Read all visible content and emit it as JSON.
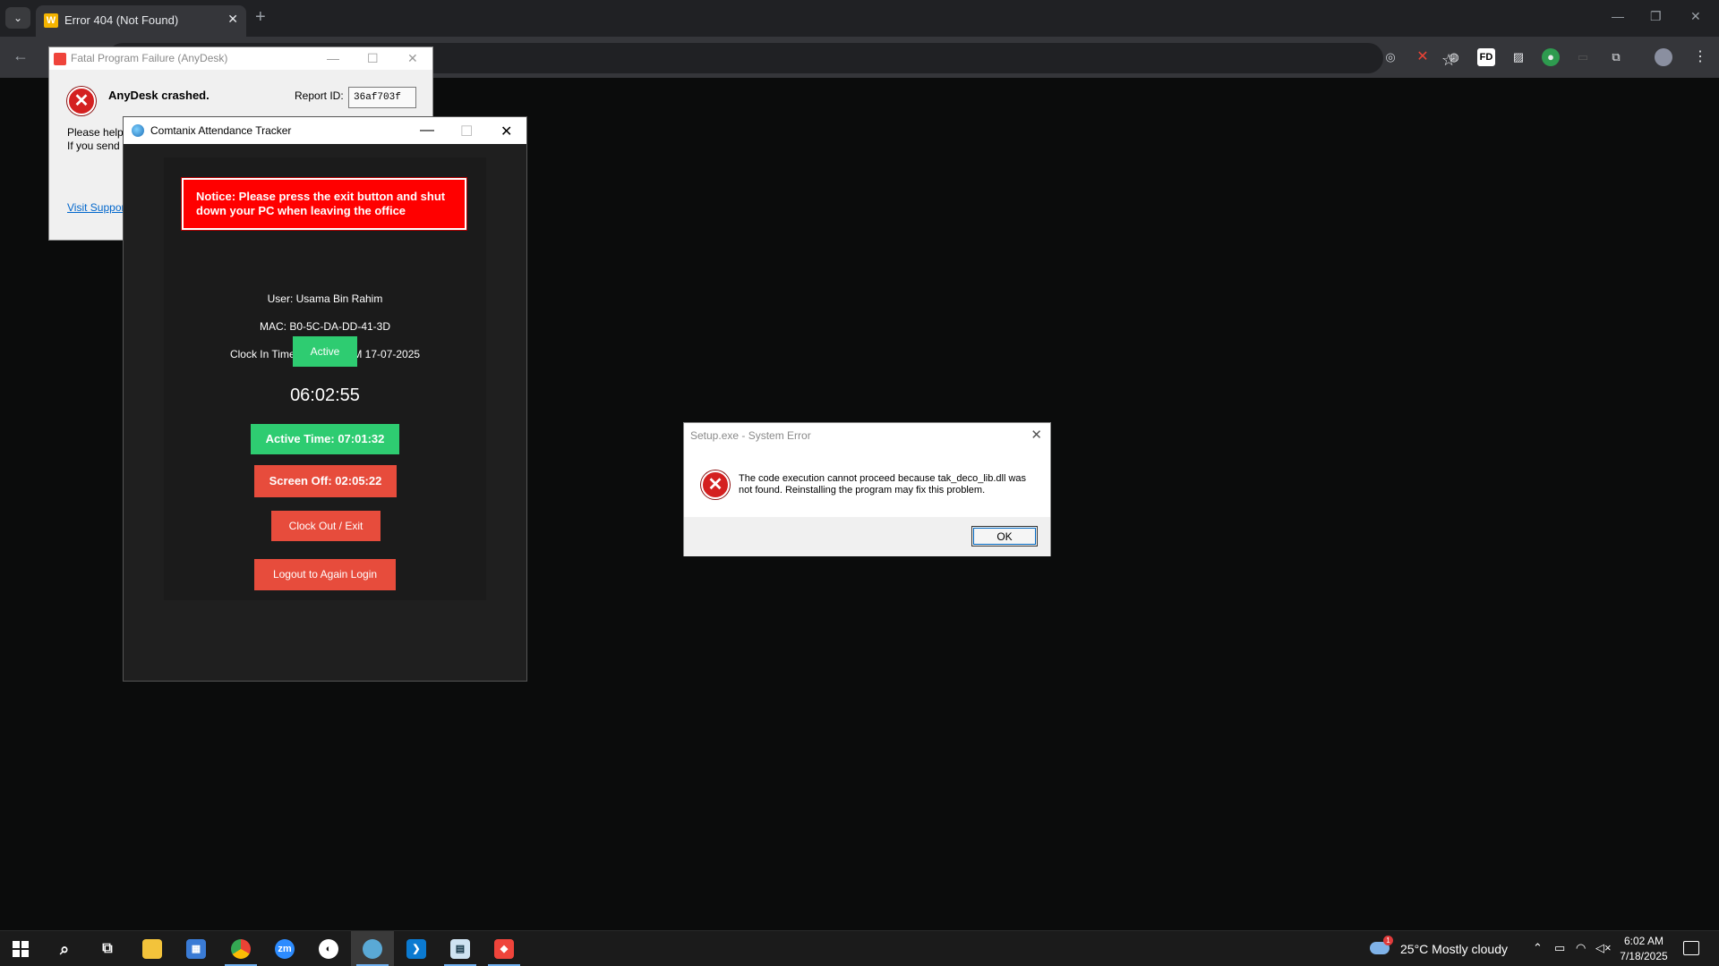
{
  "browser": {
    "tab_title": "Error 404 (Not Found)",
    "tab_favicon": "W",
    "new_tab": "+",
    "tab_close": "✕",
    "star_icon": "☆",
    "extensions_label": "FD"
  },
  "anydesk": {
    "title": "Fatal Program Failure (AnyDesk)",
    "heading": "AnyDesk crashed.",
    "report_label": "Report ID:",
    "report_id": "36af703f",
    "text_line1": "Please help",
    "text_line2": "If you send",
    "support_link": "Visit Suppor"
  },
  "tracker": {
    "title": "Comtanix Attendance Tracker",
    "notice": "Notice: Please press the exit button and shut down your PC when leaving the office",
    "user": "User: Usama Bin Rahim",
    "mac": "MAC: B0-5C-DA-DD-41-3D",
    "clock_in": "Clock In Time: 04:59:51 PM 17-07-2025",
    "status": "Active",
    "clock": "06:02:55",
    "active_time": "Active Time: 07:01:32",
    "screen_off": "Screen Off: 02:05:22",
    "clockout_label": "Clock Out / Exit",
    "logout_label": "Logout to Again Login"
  },
  "syserr": {
    "title": "Setup.exe - System Error",
    "message": "The code execution cannot proceed because tak_deco_lib.dll was not found. Reinstalling the program may fix this problem.",
    "ok_label": "OK"
  },
  "taskbar": {
    "zoom_label": "zm",
    "weather": "25°C  Mostly cloudy",
    "weather_badge": "1",
    "time": "6:02 AM",
    "date": "7/18/2025"
  },
  "colors": {
    "accent_green": "#2ecc71",
    "accent_red": "#e74c3c",
    "notice_red": "#ff0000"
  }
}
